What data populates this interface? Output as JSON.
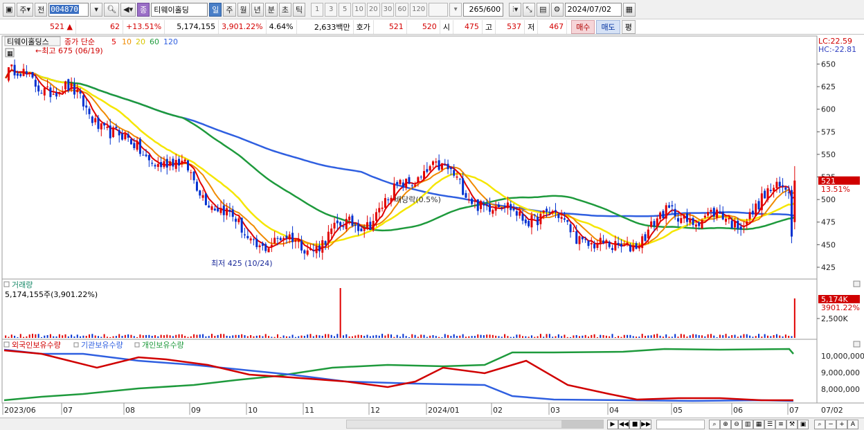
{
  "toolbar": {
    "type_label": "주",
    "prev_label": "전",
    "stock_code": "004870",
    "badge": "종",
    "stock_name": "티웨이홀딩",
    "periods": [
      "일",
      "주",
      "월",
      "년",
      "분",
      "초",
      "틱"
    ],
    "selected_period": "일",
    "intervals": [
      "1",
      "3",
      "5",
      "10",
      "20",
      "30",
      "60",
      "120"
    ],
    "count": "265",
    "count_max": "/600",
    "date": "2024/07/02"
  },
  "quote": {
    "price": "521",
    "change": "62",
    "change_pct": "+13.51%",
    "volume": "5,174,155",
    "volume_ratio": "3,901.22%",
    "turnover_rate": "4.64%",
    "amount": "2,633백만",
    "ask_label": "호가",
    "bid1": "521",
    "bid2": "520",
    "open_label": "시",
    "open": "475",
    "high_label": "고",
    "high": "537",
    "low_label": "저",
    "low": "467",
    "buy_btn": "매수",
    "sell_btn": "매도",
    "eval_btn": "평"
  },
  "price_pane": {
    "legend_name": "티웨이홀딩스",
    "legend_type": "종가 단순",
    "ma_labels": [
      "5",
      "10",
      "20",
      "60",
      "120"
    ],
    "ma_colors": [
      "#e00000",
      "#f08a00",
      "#f5e600",
      "#1e9a3c",
      "#2f5fe0"
    ],
    "high_marker": "←최고 675 (06/19)",
    "low_marker": "최저 425 (10/24)",
    "annotation": "배당락(0.5%)",
    "lc": "LC:22.59",
    "hc": "HC:-22.81",
    "current_price_tag": "521",
    "current_pct_tag": "13.51%",
    "y_ticks": [
      "650",
      "625",
      "600",
      "575",
      "550",
      "525",
      "500",
      "475",
      "450",
      "425"
    ]
  },
  "volume_pane": {
    "title": "거래량",
    "info": "5,174,155주(3,901.22%)",
    "tag1": "5,174K",
    "tag2": "3901.22%",
    "y_tick": "2,500K"
  },
  "holding_pane": {
    "labels": [
      "외국인보유수량",
      "기관보유수량",
      "개인보유수량"
    ],
    "colors": [
      "#d00000",
      "#2f5fe0",
      "#1e9a3c"
    ],
    "y_ticks": [
      "10,000,000",
      "9,000,000",
      "8,000,000"
    ]
  },
  "x_axis": [
    "2023/06",
    "07",
    "08",
    "09",
    "10",
    "11",
    "12",
    "2024/01",
    "02",
    "03",
    "04",
    "05",
    "06",
    "07"
  ],
  "x_axis_right": "07/02",
  "chart_data": {
    "type": "candlestick",
    "period": "daily",
    "highest": {
      "value": 675,
      "date": "06/19"
    },
    "lowest": {
      "value": 425,
      "date": "10/24"
    },
    "last": {
      "open": 475,
      "high": 537,
      "low": 467,
      "close": 521
    },
    "close_trend": [
      {
        "date": "2023/06",
        "close": 640
      },
      {
        "date": "07",
        "close": 620
      },
      {
        "date": "08",
        "close": 560
      },
      {
        "date": "09",
        "close": 530
      },
      {
        "date": "10",
        "close": 455
      },
      {
        "date": "11",
        "close": 450
      },
      {
        "date": "12",
        "close": 480
      },
      {
        "date": "2024/01",
        "close": 540
      },
      {
        "date": "02",
        "close": 490
      },
      {
        "date": "03",
        "close": 480
      },
      {
        "date": "04",
        "close": 440
      },
      {
        "date": "05",
        "close": 485
      },
      {
        "date": "06",
        "close": 475
      },
      {
        "date": "07",
        "close": 521
      }
    ],
    "ylim": [
      415,
      678
    ]
  }
}
